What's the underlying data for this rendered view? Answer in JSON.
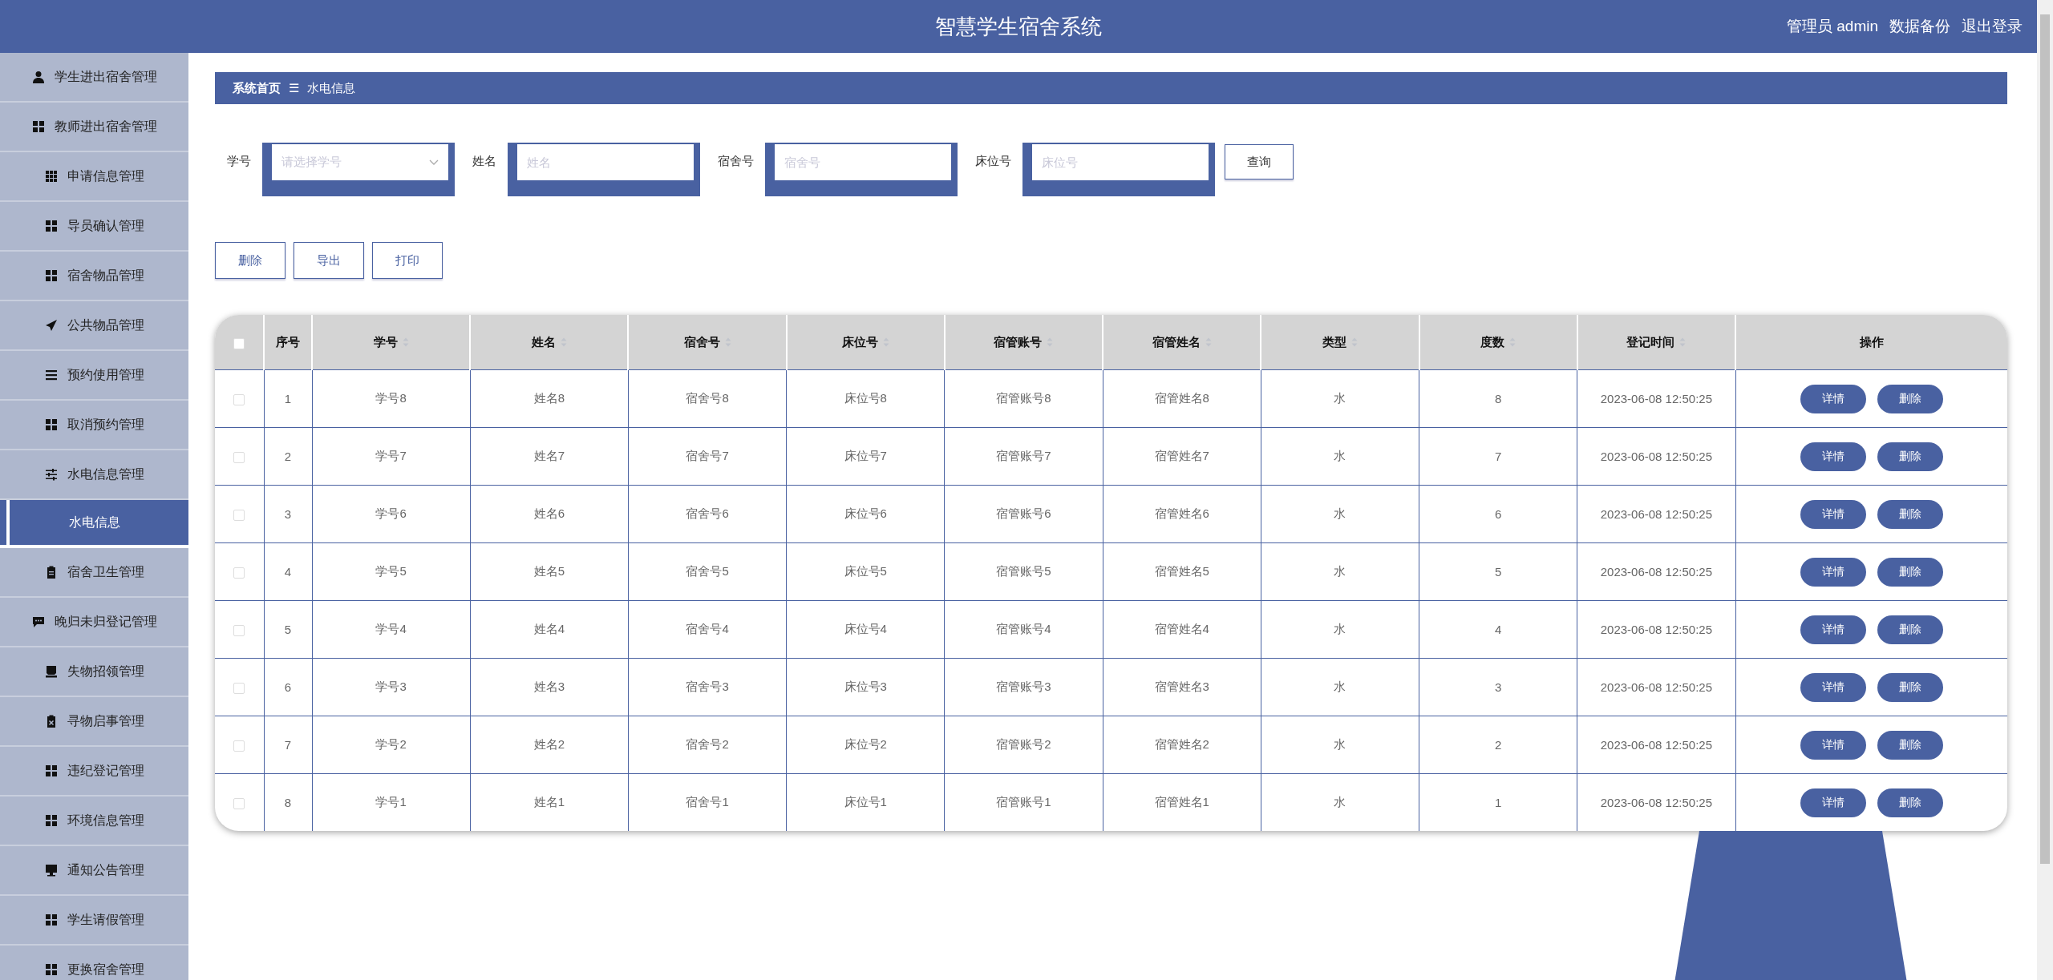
{
  "header": {
    "title": "智慧学生宿舍系统",
    "user": "管理员 admin",
    "links": [
      "数据备份",
      "退出登录"
    ]
  },
  "sidebar": {
    "items": [
      {
        "label": "学生进出宿舍管理",
        "kind": "menu",
        "selected": false
      },
      {
        "label": "教师进出宿舍管理",
        "kind": "menu",
        "selected": false
      },
      {
        "label": "申请信息管理",
        "kind": "menu",
        "selected": false
      },
      {
        "label": "导员确认管理",
        "kind": "menu",
        "selected": false
      },
      {
        "label": "宿舍物品管理",
        "kind": "menu",
        "selected": false
      },
      {
        "label": "公共物品管理",
        "kind": "menu",
        "selected": false
      },
      {
        "label": "预约使用管理",
        "kind": "menu",
        "selected": false
      },
      {
        "label": "取消预约管理",
        "kind": "menu",
        "selected": false
      },
      {
        "label": "水电信息管理",
        "kind": "menu",
        "selected": false
      },
      {
        "label": "水电信息",
        "kind": "submenu",
        "selected": true
      },
      {
        "label": "宿舍卫生管理",
        "kind": "menu",
        "selected": false
      },
      {
        "label": "晚归未归登记管理",
        "kind": "menu",
        "selected": false
      },
      {
        "label": "失物招领管理",
        "kind": "menu",
        "selected": false
      },
      {
        "label": "寻物启事管理",
        "kind": "menu",
        "selected": false
      },
      {
        "label": "违纪登记管理",
        "kind": "menu",
        "selected": false
      },
      {
        "label": "环境信息管理",
        "kind": "menu",
        "selected": false
      },
      {
        "label": "通知公告管理",
        "kind": "menu",
        "selected": false
      },
      {
        "label": "学生请假管理",
        "kind": "menu",
        "selected": false
      },
      {
        "label": "更换宿舍管理",
        "kind": "menu",
        "selected": false
      }
    ]
  },
  "breadcrumb": {
    "home": "系统首页",
    "separator": "☰",
    "current": "水电信息"
  },
  "search": {
    "fields": [
      {
        "label": "学号",
        "kind": "select",
        "placeholder": "请选择学号"
      },
      {
        "label": "姓名",
        "kind": "text",
        "placeholder": "姓名"
      },
      {
        "label": "宿舍号",
        "kind": "text",
        "placeholder": "宿舍号"
      },
      {
        "label": "床位号",
        "kind": "text",
        "placeholder": "床位号"
      }
    ],
    "button": "查询"
  },
  "actions": [
    "删除",
    "导出",
    "打印"
  ],
  "table": {
    "select_all": {
      "checked": false
    },
    "columns": [
      {
        "label": "序号",
        "sortable": false
      },
      {
        "label": "学号",
        "sortable": true
      },
      {
        "label": "姓名",
        "sortable": true
      },
      {
        "label": "宿舍号",
        "sortable": true
      },
      {
        "label": "床位号",
        "sortable": true
      },
      {
        "label": "宿管账号",
        "sortable": true
      },
      {
        "label": "宿管姓名",
        "sortable": true
      },
      {
        "label": "类型",
        "sortable": true
      },
      {
        "label": "度数",
        "sortable": true
      },
      {
        "label": "登记时间",
        "sortable": true
      },
      {
        "label": "操作",
        "sortable": false
      }
    ],
    "rows": [
      {
        "checked": false,
        "cells": [
          "1",
          "学号8",
          "姓名8",
          "宿舍号8",
          "床位号8",
          "宿管账号8",
          "宿管姓名8",
          "水",
          "8",
          "2023-06-08 12:50:25"
        ],
        "buttons": [
          "详情",
          "删除"
        ]
      },
      {
        "checked": false,
        "cells": [
          "2",
          "学号7",
          "姓名7",
          "宿舍号7",
          "床位号7",
          "宿管账号7",
          "宿管姓名7",
          "水",
          "7",
          "2023-06-08 12:50:25"
        ],
        "buttons": [
          "详情",
          "删除"
        ]
      },
      {
        "checked": false,
        "cells": [
          "3",
          "学号6",
          "姓名6",
          "宿舍号6",
          "床位号6",
          "宿管账号6",
          "宿管姓名6",
          "水",
          "6",
          "2023-06-08 12:50:25"
        ],
        "buttons": [
          "详情",
          "删除"
        ]
      },
      {
        "checked": false,
        "cells": [
          "4",
          "学号5",
          "姓名5",
          "宿舍号5",
          "床位号5",
          "宿管账号5",
          "宿管姓名5",
          "水",
          "5",
          "2023-06-08 12:50:25"
        ],
        "buttons": [
          "详情",
          "删除"
        ]
      },
      {
        "checked": false,
        "cells": [
          "5",
          "学号4",
          "姓名4",
          "宿舍号4",
          "床位号4",
          "宿管账号4",
          "宿管姓名4",
          "水",
          "4",
          "2023-06-08 12:50:25"
        ],
        "buttons": [
          "详情",
          "删除"
        ]
      },
      {
        "checked": false,
        "cells": [
          "6",
          "学号3",
          "姓名3",
          "宿舍号3",
          "床位号3",
          "宿管账号3",
          "宿管姓名3",
          "水",
          "3",
          "2023-06-08 12:50:25"
        ],
        "buttons": [
          "详情",
          "删除"
        ]
      },
      {
        "checked": false,
        "cells": [
          "7",
          "学号2",
          "姓名2",
          "宿舍号2",
          "床位号2",
          "宿管账号2",
          "宿管姓名2",
          "水",
          "2",
          "2023-06-08 12:50:25"
        ],
        "buttons": [
          "详情",
          "删除"
        ]
      },
      {
        "checked": false,
        "cells": [
          "8",
          "学号1",
          "姓名1",
          "宿舍号1",
          "床位号1",
          "宿管账号1",
          "宿管姓名1",
          "水",
          "1",
          "2023-06-08 12:50:25"
        ],
        "buttons": [
          "详情",
          "删除"
        ]
      }
    ]
  }
}
